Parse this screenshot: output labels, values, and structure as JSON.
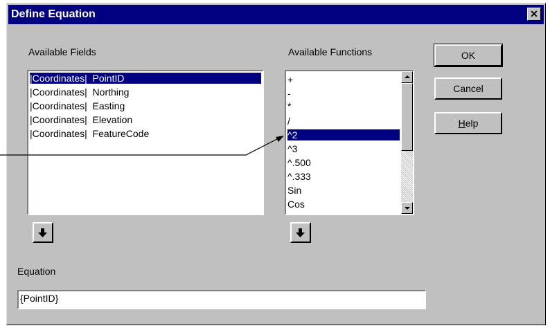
{
  "dialog": {
    "title": "Define Equation",
    "close_glyph": "✕"
  },
  "fields": {
    "label": "Available Fields",
    "items": [
      "|Coordinates|  PointID",
      "|Coordinates|  Northing",
      "|Coordinates|  Easting",
      "|Coordinates|  Elevation",
      "|Coordinates|  FeatureCode"
    ],
    "selected_index": 0
  },
  "functions": {
    "label": "Available Functions",
    "items": [
      "+",
      "-",
      "*",
      "/",
      "^2",
      "^3",
      "^.500",
      "^.333",
      "Sin",
      "Cos"
    ],
    "selected_index": 4
  },
  "buttons": {
    "ok": "OK",
    "cancel": "Cancel",
    "help_mnemonic": "H",
    "help_rest": "elp"
  },
  "equation": {
    "label": "Equation",
    "value": "{PointID}"
  },
  "icons": {
    "insert_arrow": "arrow-down-icon",
    "close": "close-icon"
  }
}
